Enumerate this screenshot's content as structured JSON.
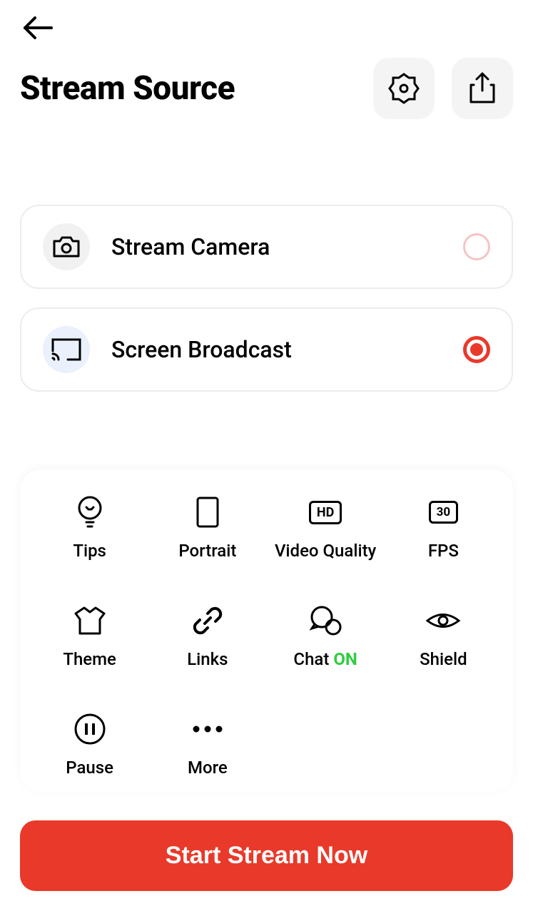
{
  "header": {
    "title": "Stream Source"
  },
  "sources": [
    {
      "label": "Stream Camera",
      "selected": false
    },
    {
      "label": "Screen Broadcast",
      "selected": true
    }
  ],
  "options": {
    "tips": "Tips",
    "portrait": "Portrait",
    "video_quality": "Video Quality",
    "video_quality_badge": "HD",
    "fps": "FPS",
    "fps_badge": "30",
    "theme": "Theme",
    "links": "Links",
    "chat_label": "Chat",
    "chat_status": "ON",
    "shield": "Shield",
    "pause": "Pause",
    "more": "More"
  },
  "cta": {
    "start": "Start Stream Now"
  }
}
